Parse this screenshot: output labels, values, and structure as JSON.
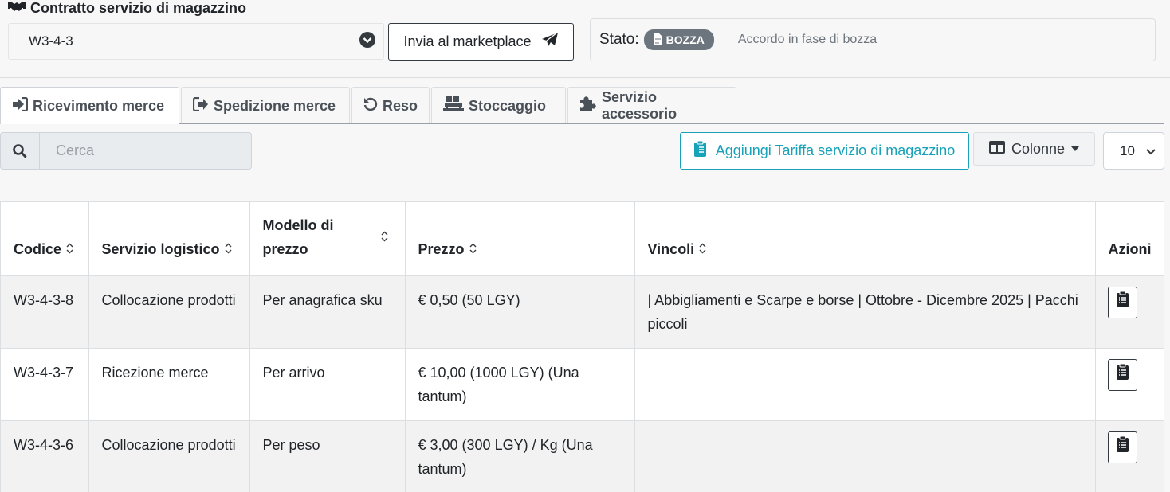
{
  "contract": {
    "title": "Contratto servizio di magazzino",
    "selected": "W3-4-3",
    "send_button": "Invia al marketplace"
  },
  "status": {
    "label": "Stato:",
    "badge": "BOZZA",
    "description": "Accordo in fase di bozza"
  },
  "tabs": [
    {
      "label": "Ricevimento merce",
      "icon": "sign-in-icon"
    },
    {
      "label": "Spedizione merce",
      "icon": "sign-out-icon"
    },
    {
      "label": "Reso",
      "icon": "undo-icon"
    },
    {
      "label": "Stoccaggio",
      "icon": "pallet-icon"
    },
    {
      "label": "Servizio accessorio",
      "icon": "puzzle-icon"
    }
  ],
  "toolbar": {
    "search_placeholder": "Cerca",
    "add_button": "Aggiungi Tariffa servizio di magazzino",
    "columns_button": "Colonne",
    "page_size": "10"
  },
  "table": {
    "headers": [
      "Codice",
      "Servizio logistico",
      "Modello di prezzo",
      "Prezzo",
      "Vincoli",
      "Azioni"
    ],
    "rows": [
      {
        "codice": "W3-4-3-8",
        "servizio": "Collocazione prodotti",
        "modello": "Per anagrafica sku",
        "prezzo": "€ 0,50 (50 LGY)",
        "vincoli": "| Abbigliamenti e Scarpe e borse | Ottobre - Dicembre 2025 | Pacchi piccoli"
      },
      {
        "codice": "W3-4-3-7",
        "servizio": "Ricezione merce",
        "modello": "Per arrivo",
        "prezzo": "€ 10,00 (1000 LGY) (Una tantum)",
        "vincoli": ""
      },
      {
        "codice": "W3-4-3-6",
        "servizio": "Collocazione prodotti",
        "modello": "Per peso",
        "prezzo": "€ 3,00 (300 LGY) / Kg (Una tantum)",
        "vincoli": ""
      }
    ]
  },
  "colors": {
    "accent": "#17a2b8",
    "badge": "#6c757d",
    "border": "#dcdfe2"
  }
}
